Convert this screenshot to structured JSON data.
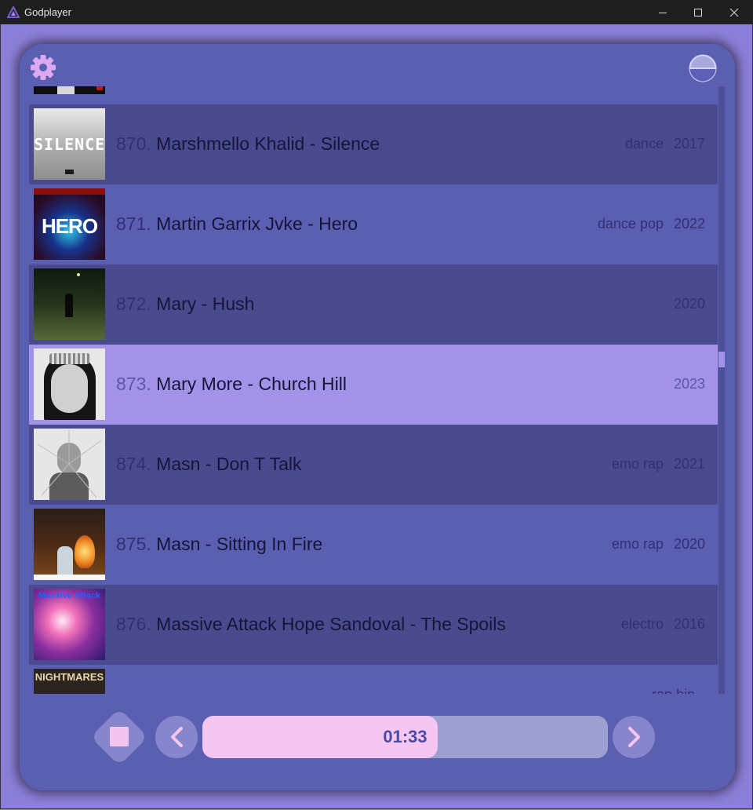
{
  "window": {
    "title": "Godplayer"
  },
  "colors": {
    "accent": "#a293e8",
    "panel": "#5b5fb2",
    "row_dark": "#4a4b8f",
    "progress_fill": "#f5c6f1"
  },
  "toolbar": {
    "settings_icon": "gear-icon",
    "theme_icon": "half-circle-icon"
  },
  "tracks": [
    {
      "number": "870.",
      "title": "Marshmello Khalid - Silence",
      "genre": "dance",
      "year": "2017",
      "cover_text": "SILENCE"
    },
    {
      "number": "871.",
      "title": "Martin Garrix Jvke - Hero",
      "genre": "dance pop",
      "year": "2022",
      "cover_text": "HERO"
    },
    {
      "number": "872.",
      "title": "Mary - Hush",
      "genre": "",
      "year": "2020"
    },
    {
      "number": "873.",
      "title": "Mary More - Church Hill",
      "genre": "",
      "year": "2023"
    },
    {
      "number": "874.",
      "title": "Masn - Don T Talk",
      "genre": "emo rap",
      "year": "2021"
    },
    {
      "number": "875.",
      "title": "Masn - Sitting In Fire",
      "genre": "emo rap",
      "year": "2020"
    },
    {
      "number": "876.",
      "title": "Massive Attack Hope Sandoval - The Spoils",
      "genre": "electro",
      "year": "2016",
      "cover_text": "Massive Attack"
    },
    {
      "number": "",
      "title": "",
      "genre": "rap hip",
      "year": "",
      "cover_text": "NIGHTMARES"
    }
  ],
  "player": {
    "time": "01:33",
    "progress": 0.58
  }
}
